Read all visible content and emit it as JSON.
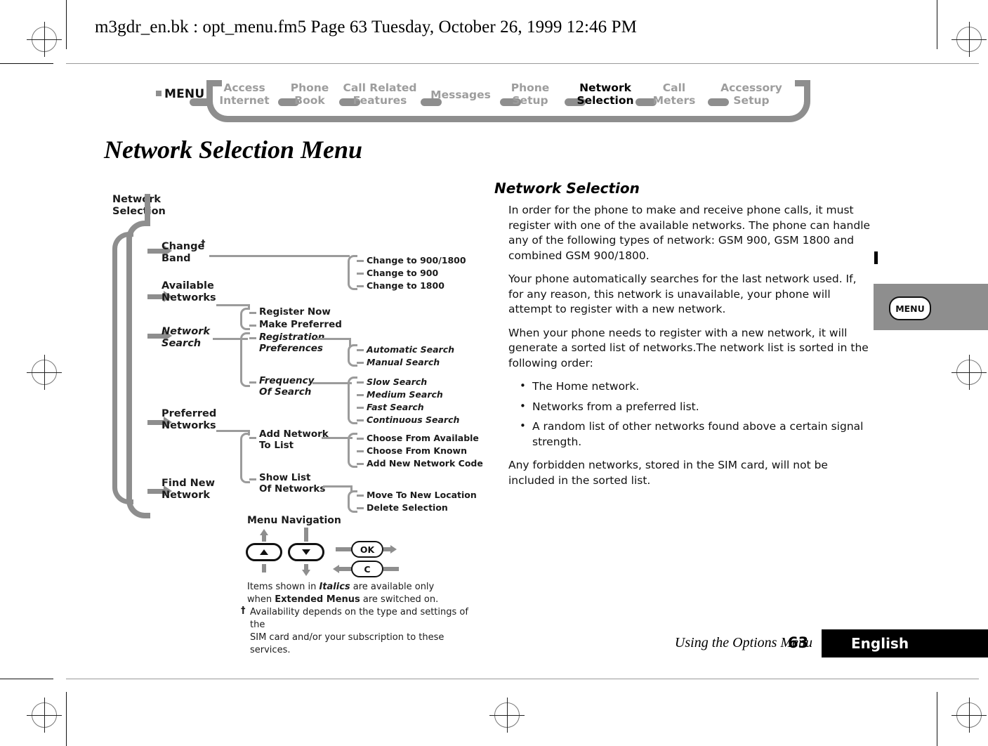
{
  "document_header": "m3gdr_en.bk : opt_menu.fm5  Page 63  Tuesday, October 26, 1999  12:46 PM",
  "page_title": "Network Selection Menu",
  "breadcrumb": {
    "menu_label": "MENU",
    "items": [
      {
        "line1": "Access",
        "line2": "Internet",
        "active": false
      },
      {
        "line1": "Phone",
        "line2": "Book",
        "active": false
      },
      {
        "line1": "Call Related",
        "line2": "Features",
        "active": false
      },
      {
        "line1": "Messages",
        "line2": "",
        "active": false
      },
      {
        "line1": "Phone",
        "line2": "Setup",
        "active": false
      },
      {
        "line1": "Network",
        "line2": "Selection",
        "active": true
      },
      {
        "line1": "Call",
        "line2": "Meters",
        "active": false
      },
      {
        "line1": "Accessory",
        "line2": "Setup",
        "active": false
      }
    ]
  },
  "diagram": {
    "root": "Network\nSelection",
    "level1": [
      {
        "label": "Change\nBand",
        "italic": false,
        "dagger": true
      },
      {
        "label": "Available\nNetworks",
        "italic": false,
        "dagger": false
      },
      {
        "label": "Network\nSearch",
        "italic": true,
        "dagger": false
      },
      {
        "label": "Preferred\nNetworks",
        "italic": false,
        "dagger": false
      },
      {
        "label": "Find New\nNetwork",
        "italic": false,
        "dagger": false
      }
    ],
    "change_band_options": [
      "Change to 900/1800",
      "Change to 900",
      "Change to 1800"
    ],
    "available_networks_options": [
      "Register Now",
      "Make Preferred"
    ],
    "network_search_options": [
      "Registration\nPreferences",
      "Frequency\nOf Search"
    ],
    "registration_preferences_options": [
      "Automatic Search",
      "Manual Search"
    ],
    "frequency_of_search_options": [
      "Slow Search",
      "Medium Search",
      "Fast Search",
      "Continuous Search"
    ],
    "preferred_networks_options": [
      "Add Network\nTo List",
      "Show List\nOf Networks"
    ],
    "add_network_options": [
      "Choose From Available",
      "Choose From Known",
      "Add New Network Code"
    ],
    "show_list_options": [
      "Move To New Location",
      "Delete Selection"
    ]
  },
  "legend": {
    "title": "Menu Navigation",
    "buttons": {
      "up": "▲",
      "down": "▼",
      "ok": "OK",
      "clear": "C"
    },
    "note_line1_a": "Items shown in ",
    "note_line1_i": "Italics",
    "note_line1_b": " are available only",
    "note_line2_a": "when ",
    "note_line2_b": "Extended Menus",
    "note_line2_c": " are switched on.",
    "dagger": "†",
    "note_line3": "Availability depends on the type and settings of the",
    "note_line4": "SIM card and/or your subscription to these services."
  },
  "section": {
    "heading": "Network Selection",
    "paragraphs": [
      "In order for the phone to make and receive phone calls, it must register with one of the available networks. The phone can handle any of the following types of network: GSM 900, GSM 1800 and combined GSM 900/1800.",
      "Your phone automatically searches for the last network used. If, for any reason, this network is unavailable, your phone will attempt to register with a new network.",
      "When your phone needs to register with a new network, it will generate a sorted list of networks.The network list is sorted in the following order:"
    ],
    "bullets": [
      "The Home network.",
      "Networks from a preferred list.",
      "A random list of other networks found above a certain signal strength."
    ],
    "closing": "Any forbidden networks, stored in the SIM card, will not be included in the sorted list."
  },
  "side_tab": {
    "label": "MENU"
  },
  "footer": {
    "chapter": "Using the Options Menu",
    "page_number": "63",
    "language": "English"
  },
  "colors": {
    "gray": "#8e8e8e",
    "light_gray": "#9b9b9b",
    "black": "#000000"
  }
}
